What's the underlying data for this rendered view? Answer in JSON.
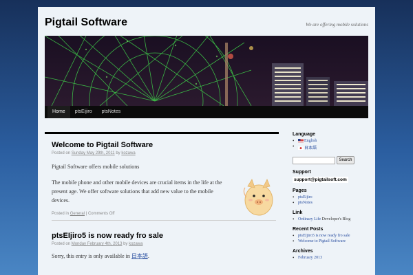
{
  "site": {
    "title": "Pigtail Software",
    "description": "We are offering mobile solutions"
  },
  "nav": {
    "items": [
      {
        "label": "Home",
        "current": true
      },
      {
        "label": "ptsEijiro",
        "current": false
      },
      {
        "label": "ptsNotes",
        "current": false
      }
    ]
  },
  "posts": [
    {
      "title": "Welcome to Pigtail Software",
      "meta_prefix": "Posted on",
      "date": "Sunday May 29th, 2011",
      "by": "by",
      "author": "kozawa",
      "paragraphs": [
        "Pigtail Software offers mobile solutions",
        "The mobile phone and other mobile devices are crucial items in the life at the present age. We offer software solutions that add new value to the mobile devices."
      ],
      "footer_prefix": "Posted in",
      "category": "General",
      "separator": "|",
      "comments": "Comments Off"
    },
    {
      "title": "ptsEIjiro5 is now ready fro sale",
      "meta_prefix": "Posted on",
      "date": "Monday February 4th, 2013",
      "by": "by",
      "author": "kozawa",
      "body_prefix": "Sorry, this entry is only available in",
      "body_link": "日本語",
      "body_suffix": "."
    }
  ],
  "sidebar": {
    "language": {
      "title": "Language",
      "items": [
        {
          "label": "English",
          "flag": "us-flag"
        },
        {
          "label": "日本語",
          "flag": "japan-flag"
        }
      ]
    },
    "search": {
      "placeholder": "",
      "button": "Search"
    },
    "support": {
      "title": "Support",
      "email": "support@pigtailsoft.com"
    },
    "pages": {
      "title": "Pages",
      "items": [
        "ptsEijiro",
        "ptsNotes"
      ]
    },
    "link": {
      "title": "Link",
      "link_text": "Ordinary Life",
      "note": "Developer's Blog"
    },
    "recent_posts": {
      "title": "Recent Posts",
      "items": [
        "ptsEIjiro5 is now ready fro sale",
        "Welcome to Pigtail Software"
      ]
    },
    "archives": {
      "title": "Archives",
      "items": [
        "February 2013"
      ]
    }
  },
  "colors": {
    "background_top": "#17305a",
    "background_bottom": "#4a86c4",
    "page": "#eef3f8",
    "nav": "#0b0b0b",
    "link": "#2a4fa0"
  }
}
